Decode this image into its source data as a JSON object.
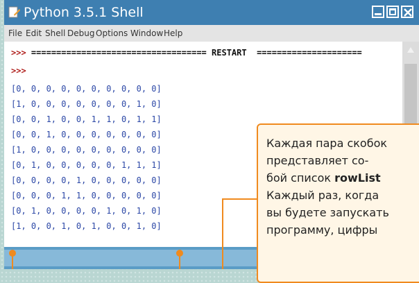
{
  "window": {
    "title": "Python 3.5.1 Shell",
    "accent": "#3e7fb1"
  },
  "menu": [
    "File",
    "Edit",
    "Shell",
    "Debug",
    "Options",
    "Window",
    "Help"
  ],
  "console": {
    "prompt": ">>>",
    "restart_left": "===================================",
    "restart_label": "RESTART",
    "restart_right": "=====================",
    "rows": [
      "[0, 0, 0, 0, 0, 0, 0, 0, 0, 0]",
      "[1, 0, 0, 0, 0, 0, 0, 0, 1, 0]",
      "[0, 0, 1, 0, 0, 1, 1, 0, 1, 1]",
      "[0, 0, 1, 0, 0, 0, 0, 0, 0, 0]",
      "[1, 0, 0, 0, 0, 0, 0, 0, 0, 0]",
      "[0, 1, 0, 0, 0, 0, 0, 1, 1, 1]",
      "[0, 0, 0, 0, 1, 0, 0, 0, 0, 0]",
      "[0, 0, 0, 1, 1, 0, 0, 0, 0, 0]",
      "[0, 1, 0, 0, 0, 0, 1, 0, 1, 0]",
      "[1, 0, 0, 1, 0, 1, 0, 0, 1, 0]"
    ]
  },
  "callout": {
    "line1": "Каждая пара скобок",
    "line2": "представляет со-",
    "line3_prefix": "бой список ",
    "line3_bold": "rowList",
    "line4": "Каждый раз, когда",
    "line5": "вы будете запускать",
    "line6": "программу, цифры"
  }
}
